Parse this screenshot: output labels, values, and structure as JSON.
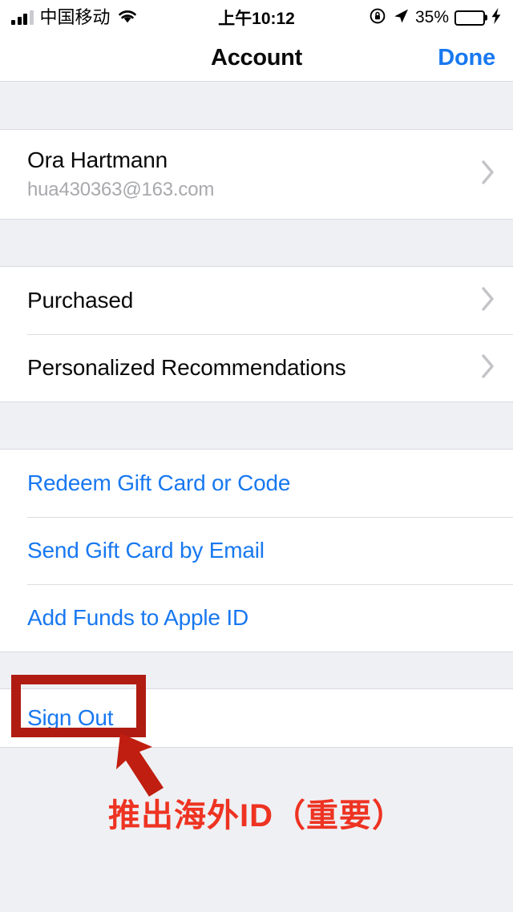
{
  "status_bar": {
    "carrier": "中国移动",
    "signal_icon": "signal-bars-icon",
    "wifi_icon": "wifi-icon",
    "time": "上午10:12",
    "rotation_lock_icon": "rotation-lock-icon",
    "location_icon": "location-arrow-icon",
    "battery_percent": "35%",
    "battery_icon": "battery-icon",
    "charging_icon": "lightning-bolt-icon",
    "battery_level": 35,
    "battery_color": "#3ED24B"
  },
  "nav": {
    "title": "Account",
    "done_label": "Done",
    "accent_color": "#1878F0"
  },
  "sections": {
    "account": {
      "name": "Ora Hartmann",
      "email": "hua430363@163.com",
      "chevron_icon": "chevron-right-icon"
    },
    "menu": [
      {
        "label": "Purchased",
        "chevron_icon": "chevron-right-icon"
      },
      {
        "label": "Personalized Recommendations",
        "chevron_icon": "chevron-right-icon"
      }
    ],
    "actions": [
      {
        "label": "Redeem Gift Card or Code"
      },
      {
        "label": "Send Gift Card by Email"
      },
      {
        "label": "Add Funds to Apple ID"
      }
    ],
    "signout": {
      "label": "Sign Out"
    }
  },
  "annotation": {
    "caption": "推出海外ID（重要）",
    "box_color": "#B01C12",
    "arrow_color": "#C01E10",
    "caption_color": "#EE3322"
  }
}
